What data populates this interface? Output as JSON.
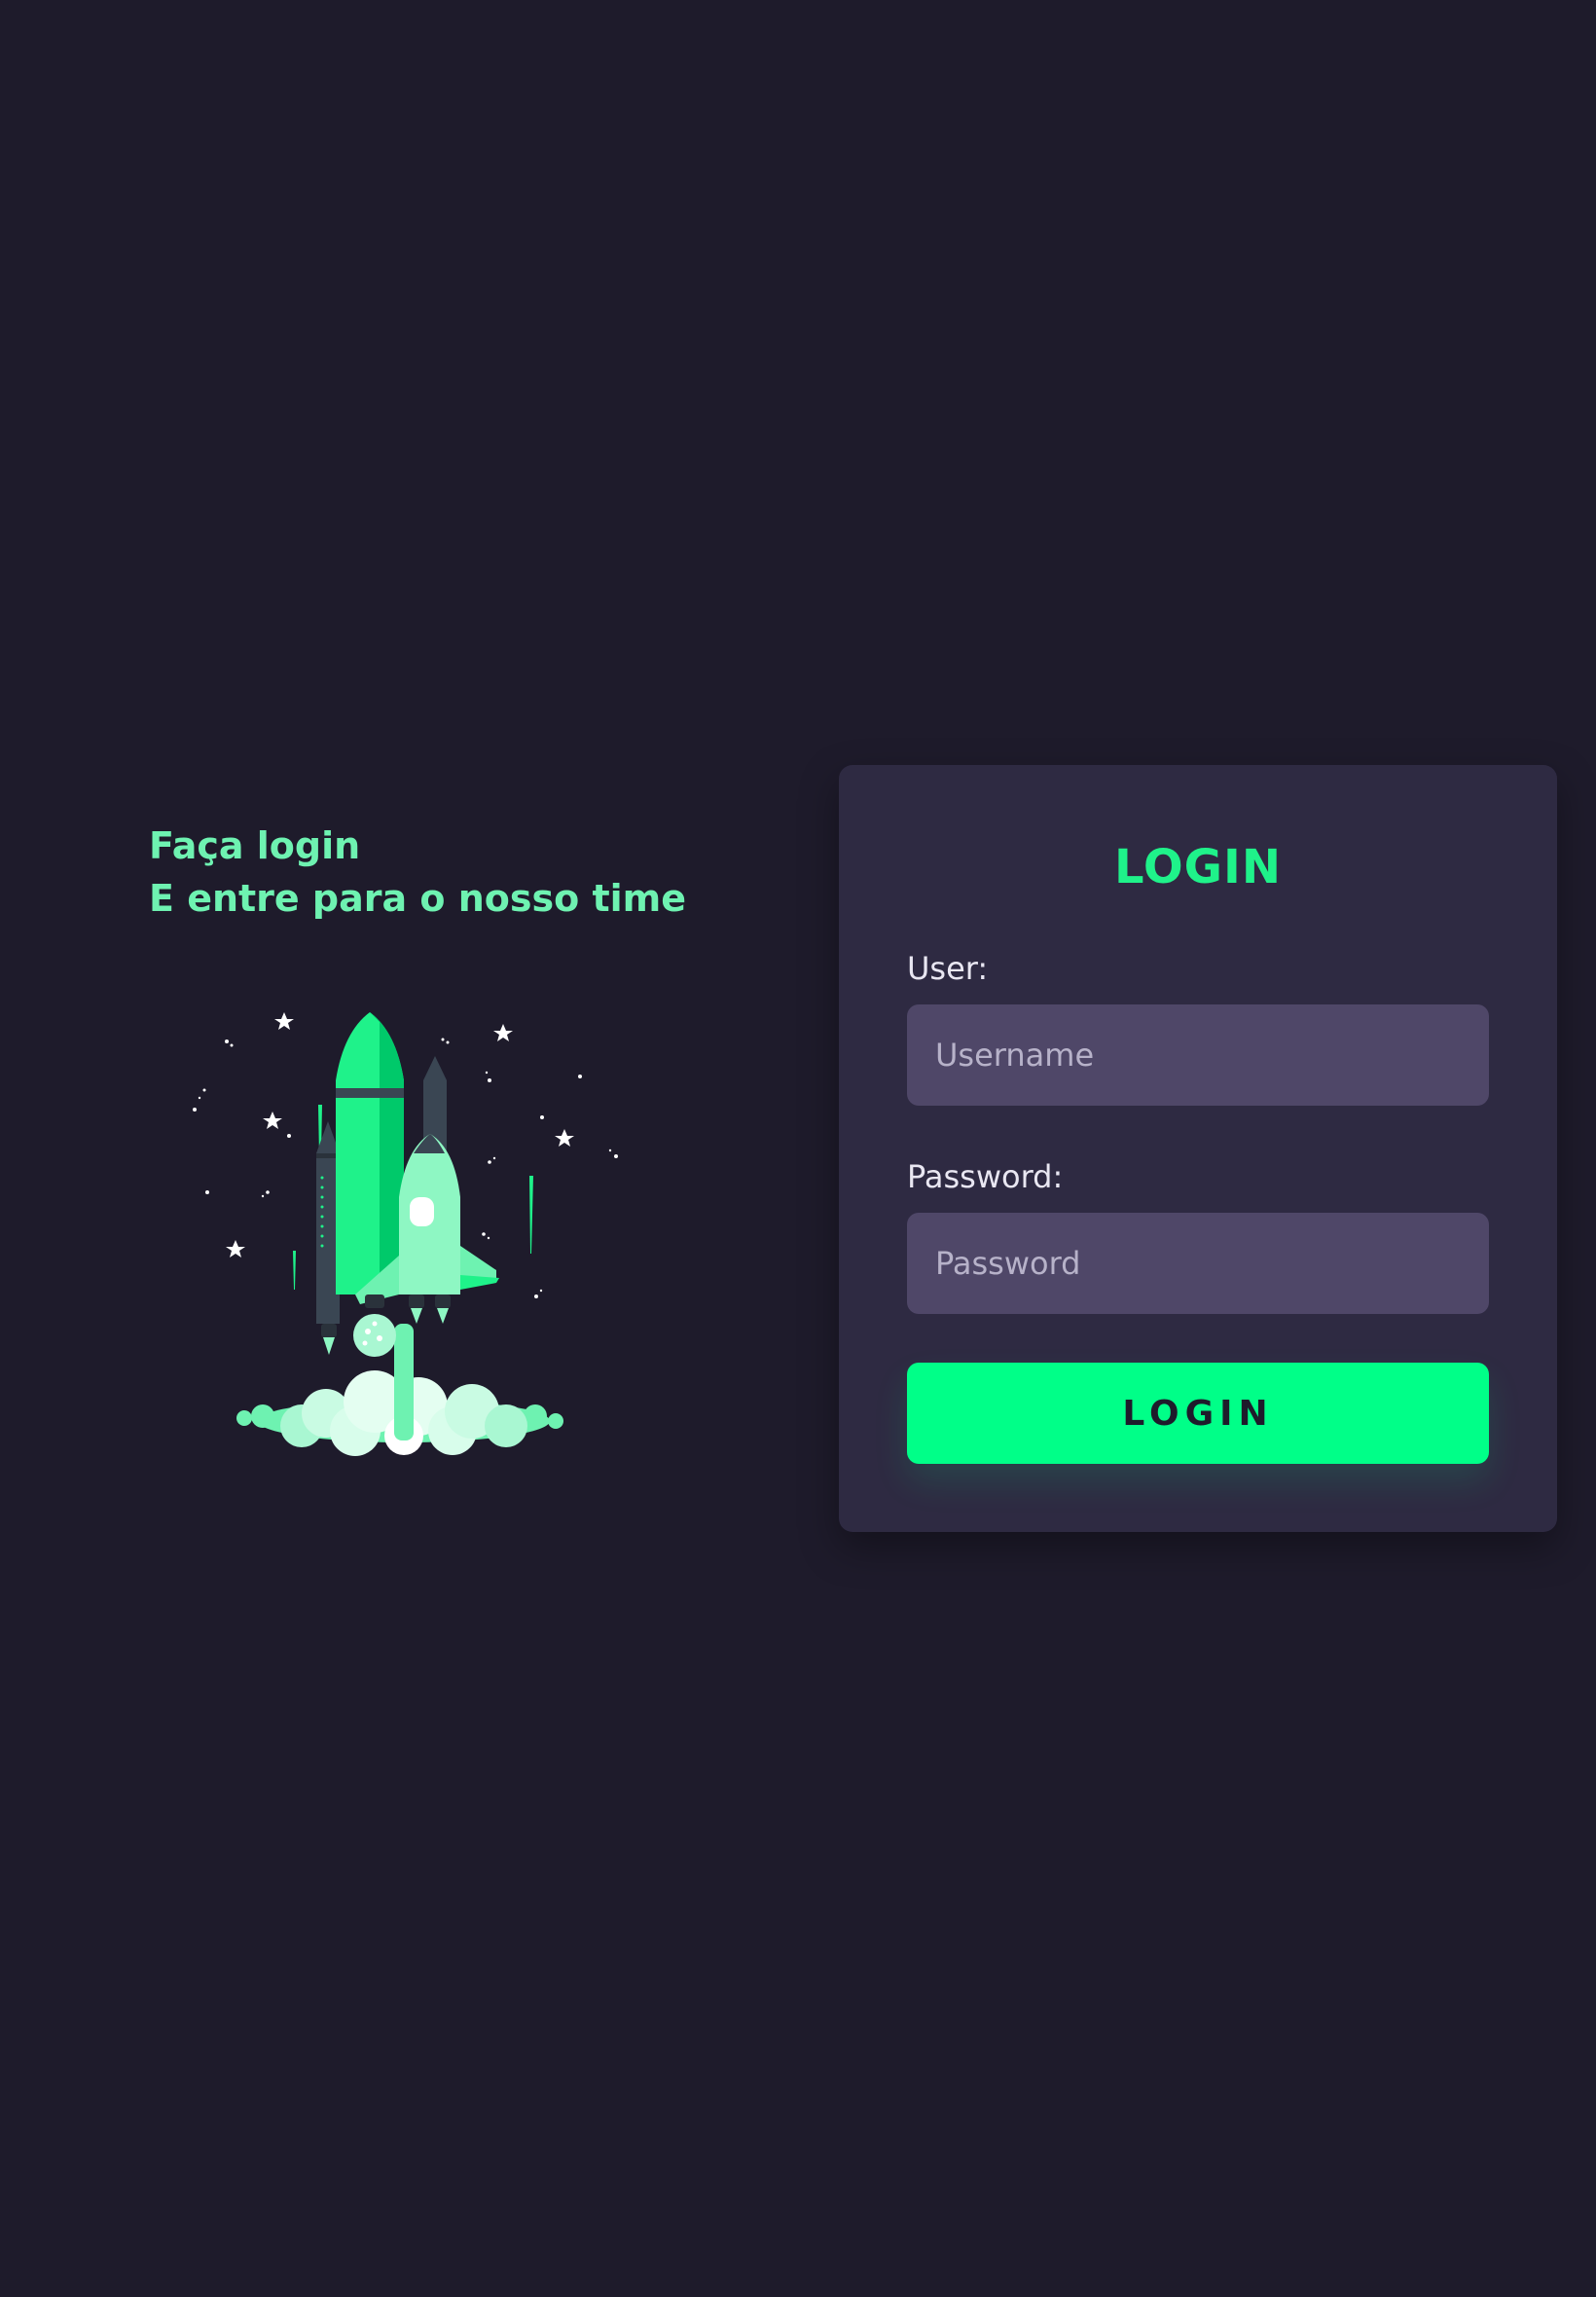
{
  "hero": {
    "line1": "Faça login",
    "line2": "E entre para o nosso time",
    "illustration": "rocket-launch-illustration"
  },
  "login": {
    "title": "LOGIN",
    "user_label": "User:",
    "user_placeholder": "Username",
    "user_value": "",
    "password_label": "Password:",
    "password_placeholder": "Password",
    "password_value": "",
    "button_label": "LOGIN"
  },
  "colors": {
    "background": "#1e1b2b",
    "card": "#2e2a42",
    "input": "#4f4768",
    "accent": "#00ff88",
    "heading_text": "#6ef2b1"
  }
}
